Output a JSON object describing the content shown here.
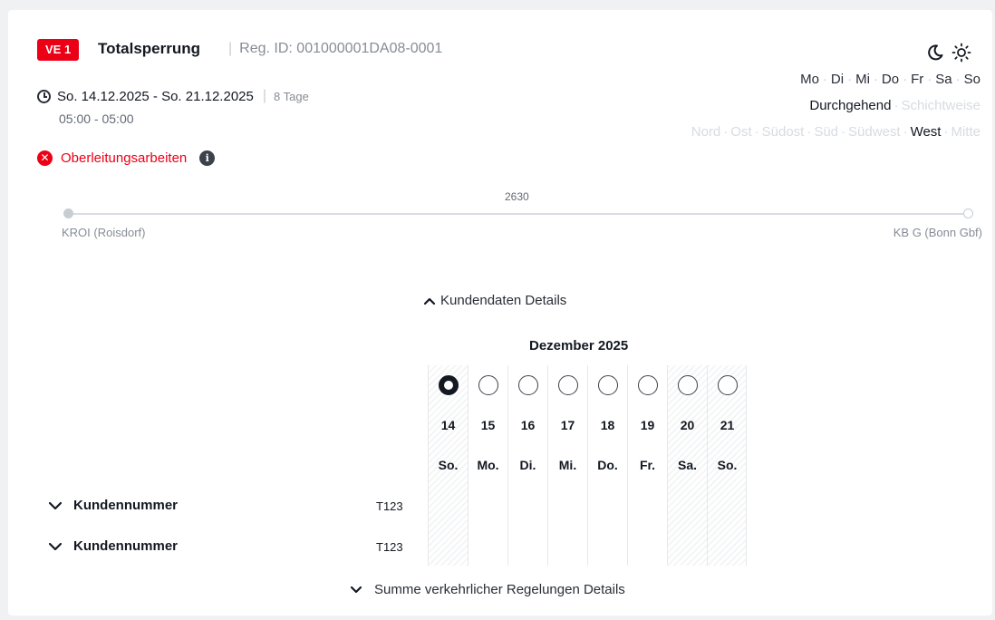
{
  "header": {
    "badge": "VE 1",
    "title": "Totalsperrung",
    "separator": "|",
    "reg_id": "Reg. ID: 001000001DA08-0001"
  },
  "schedule": {
    "date_range": "So. 14.12.2025 - So. 21.12.2025",
    "duration": "8 Tage",
    "time": "05:00 - 05:00"
  },
  "reason": {
    "label": "Oberleitungsarbeiten"
  },
  "weekdays": [
    "Mo",
    "Di",
    "Mi",
    "Do",
    "Fr",
    "Sa",
    "So"
  ],
  "mode": {
    "active": "Durchgehend",
    "inactive": "Schichtweise"
  },
  "directions": {
    "before_active": [
      "Nord",
      "Ost",
      "Südost",
      "Süd",
      "Südwest"
    ],
    "active": "West",
    "after_active": [
      "Mitte"
    ]
  },
  "route": {
    "km": "2630",
    "start": "KROI (Roisdorf)",
    "end": "KB G (Bonn Gbf)"
  },
  "details": {
    "toggle_label": "Kundendaten Details",
    "month": "Dezember 2025",
    "days": [
      {
        "num": "14",
        "name": "So.",
        "selected": true,
        "weekend": true
      },
      {
        "num": "15",
        "name": "Mo.",
        "selected": false,
        "weekend": false
      },
      {
        "num": "16",
        "name": "Di.",
        "selected": false,
        "weekend": false
      },
      {
        "num": "17",
        "name": "Mi.",
        "selected": false,
        "weekend": false
      },
      {
        "num": "18",
        "name": "Do.",
        "selected": false,
        "weekend": false
      },
      {
        "num": "19",
        "name": "Fr.",
        "selected": false,
        "weekend": false
      },
      {
        "num": "20",
        "name": "Sa.",
        "selected": false,
        "weekend": true
      },
      {
        "num": "21",
        "name": "So.",
        "selected": false,
        "weekend": true
      }
    ],
    "rows": [
      {
        "label": "Kundennummer",
        "value": "T123"
      },
      {
        "label": "Kundennummer",
        "value": "T123"
      }
    ]
  },
  "summary_toggle": "Summe verkehrlicher Regelungen Details",
  "colors": {
    "accent_red": "#ec0016",
    "text_dark": "#131821",
    "muted": "#878c96"
  },
  "icons": [
    "clock-icon",
    "error-icon",
    "info-icon",
    "moon-icon",
    "sun-icon",
    "chevron-up-icon",
    "chevron-down-icon"
  ]
}
